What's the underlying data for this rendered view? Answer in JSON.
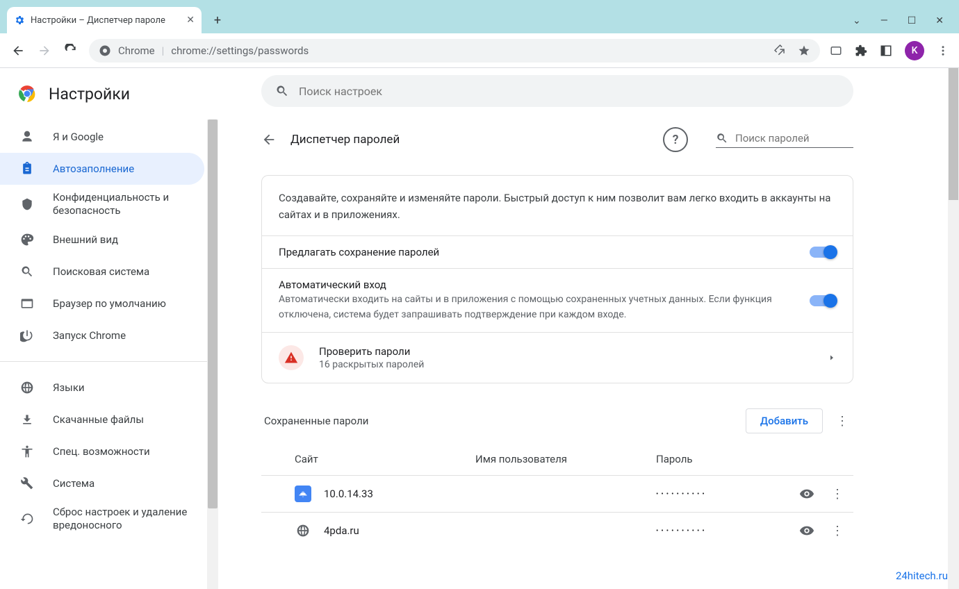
{
  "window": {
    "tab_title": "Настройки – Диспетчер пароле",
    "dropdown": "⌄",
    "minimize": "—",
    "maximize": "☐",
    "close": "✕"
  },
  "toolbar": {
    "chrome_label": "Chrome",
    "url": "chrome://settings/passwords",
    "avatar_letter": "K"
  },
  "app": {
    "title": "Настройки",
    "search_placeholder": "Поиск настроек"
  },
  "sidebar": {
    "items": [
      {
        "label": "Я и Google"
      },
      {
        "label": "Автозаполнение"
      },
      {
        "label": "Конфиденциальность и безопасность"
      },
      {
        "label": "Внешний вид"
      },
      {
        "label": "Поисковая система"
      },
      {
        "label": "Браузер по умолчанию"
      },
      {
        "label": "Запуск Chrome"
      }
    ],
    "items2": [
      {
        "label": "Языки"
      },
      {
        "label": "Скачанные файлы"
      },
      {
        "label": "Спец. возможности"
      },
      {
        "label": "Система"
      },
      {
        "label": "Сброс настроек и удаление вредоносного"
      }
    ]
  },
  "panel": {
    "title": "Диспетчер паролей",
    "pw_search_placeholder": "Поиск паролей",
    "description": "Создавайте, сохраняйте и изменяйте пароли. Быстрый доступ к ним позволит вам легко входить в аккаунты на сайтах и в приложениях.",
    "offer_save": "Предлагать сохранение паролей",
    "auto_login_title": "Автоматический вход",
    "auto_login_sub": "Автоматически входить на сайты и в приложения с помощью сохраненных учетных данных. Если функция отключена, система будет запрашивать подтверждение при каждом входе.",
    "check_title": "Проверить пароли",
    "check_sub": "16 раскрытых паролей",
    "saved_title": "Сохраненные пароли",
    "add_button": "Добавить",
    "col_site": "Сайт",
    "col_user": "Имя пользователя",
    "col_pass": "Пароль",
    "rows": [
      {
        "site": "10.0.14.33",
        "user": "",
        "pass": "••••••••••"
      },
      {
        "site": "4pda.ru",
        "user": "",
        "pass": "••••••••••"
      }
    ]
  },
  "watermark": "24hitech.ru"
}
